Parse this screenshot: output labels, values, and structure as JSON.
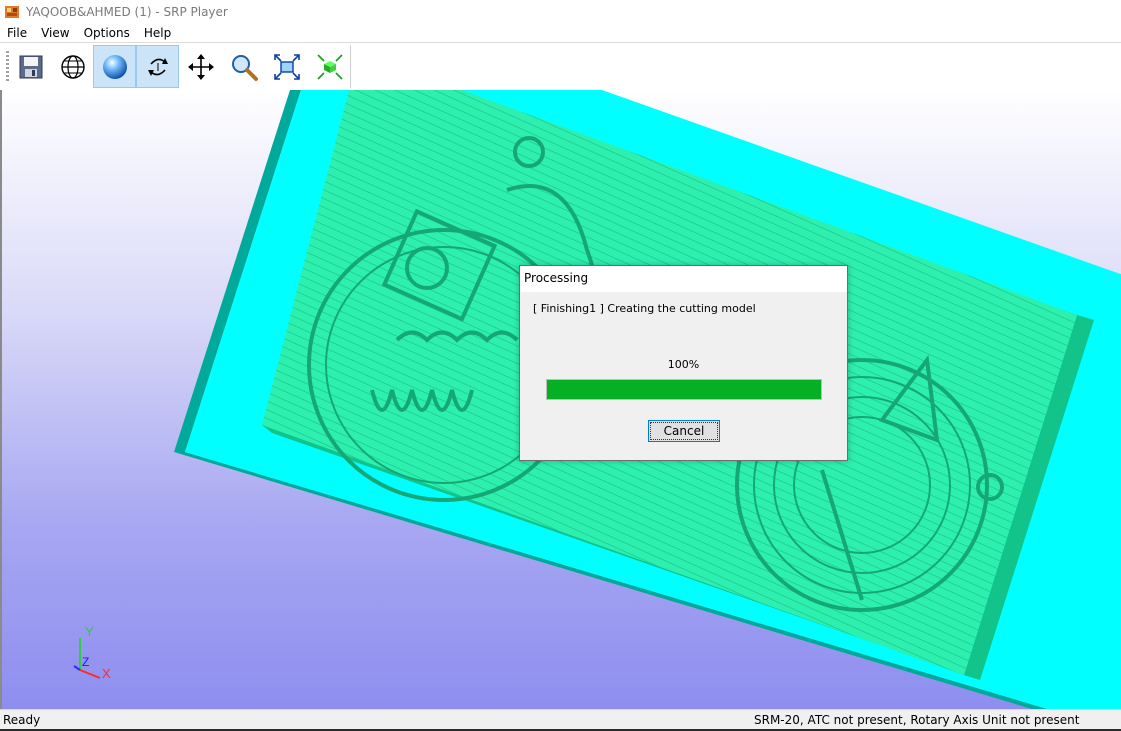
{
  "window": {
    "title": "YAQOOB&AHMED (1) - SRP Player"
  },
  "menu": {
    "items": [
      "File",
      "View",
      "Options",
      "Help"
    ]
  },
  "toolbar": {
    "buttons": [
      {
        "icon": "save-icon",
        "active": false
      },
      {
        "icon": "globe-icon",
        "active": false
      },
      {
        "icon": "sphere-shading-icon",
        "active": true
      },
      {
        "icon": "rotate-icon",
        "active": true
      },
      {
        "icon": "move-arrows-icon",
        "active": false
      },
      {
        "icon": "zoom-magnifier-icon",
        "active": false
      },
      {
        "icon": "fit-to-window-icon",
        "active": false
      },
      {
        "icon": "collapse-view-icon",
        "active": false
      }
    ]
  },
  "axes": {
    "y": "Y",
    "z": "Z",
    "x": "X"
  },
  "dialog": {
    "title": "Processing",
    "message": "[ Finishing1 ]  Creating the cutting model",
    "percent_text": "100%",
    "progress": 1.0,
    "cancel_label": "Cancel"
  },
  "status": {
    "left": "Ready",
    "right": "SRM-20, ATC not present, Rotary Axis Unit not present"
  },
  "colors": {
    "stock_top": "#00ffff",
    "stock_side": "#00a99a",
    "model": "#2ef0ae",
    "progress_fill": "#06b025",
    "background_top": "#ffffff",
    "background_bottom": "#8e8ef0"
  }
}
